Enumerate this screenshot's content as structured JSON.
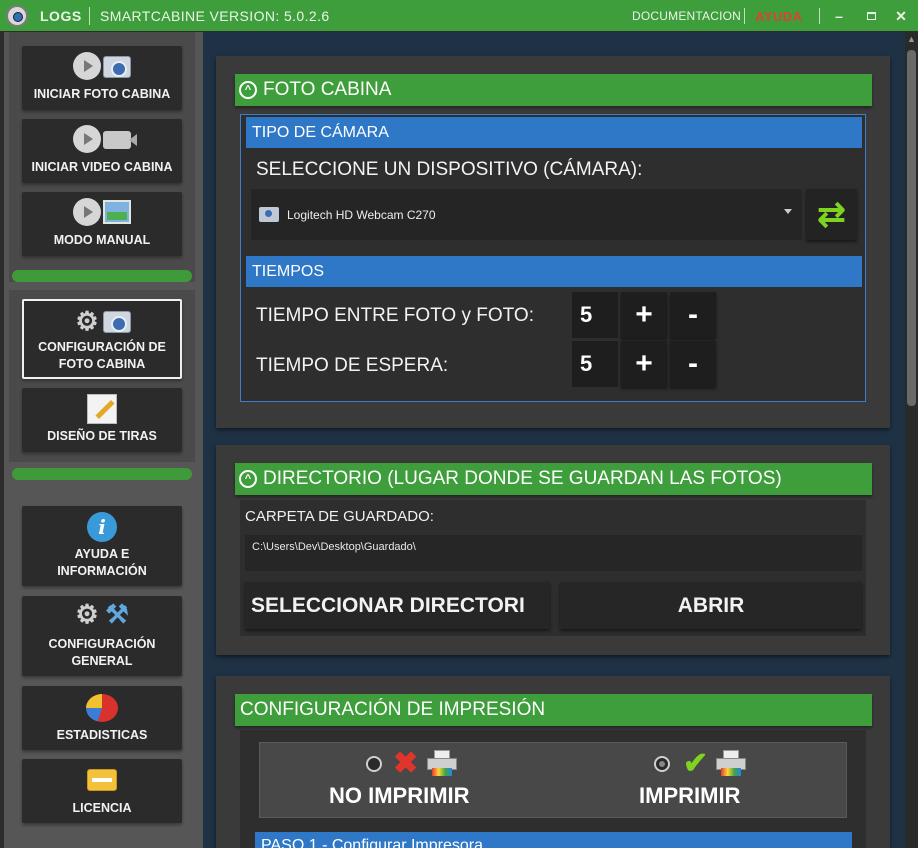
{
  "titlebar": {
    "logs_label": "LOGS",
    "version": "SMARTCABINE VERSION: 5.0.2.6",
    "documentation_link": "DOCUMENTACION",
    "help_link": "AYUDA",
    "minimize": "–",
    "maximize": "▫",
    "close": "✕"
  },
  "sidebar": {
    "group1": [
      {
        "label": "INICIAR FOTO CABINA"
      },
      {
        "label": "INICIAR VIDEO CABINA"
      },
      {
        "label": "MODO MANUAL"
      }
    ],
    "group2": [
      {
        "label_line1": "CONFIGURACIÓN DE",
        "label_line2": "FOTO CABINA"
      },
      {
        "label": "DISEÑO DE TIRAS"
      }
    ],
    "group3": [
      {
        "label_line1": "AYUDA E",
        "label_line2": "INFORMACIÓN"
      },
      {
        "label_line1": "CONFIGURACIÓN",
        "label_line2": "GENERAL"
      },
      {
        "label": "ESTADISTICAS"
      },
      {
        "label": "LICENCIA"
      }
    ]
  },
  "foto_cabina": {
    "title": "FOTO CABINA",
    "collapse_icon": "chevron-up-icon",
    "camera_type": {
      "header": "TIPO DE CÁMARA",
      "prompt": "SELECCIONE UN DISPOSITIVO (CÁMARA):",
      "selected_device": "Logitech HD Webcam C270"
    },
    "times": {
      "header": "TIEMPOS",
      "between_label": "TIEMPO ENTRE FOTO y FOTO:",
      "between_value": "5",
      "wait_label": "TIEMPO DE ESPERA:",
      "wait_value": "5",
      "plus": "+",
      "minus": "-"
    }
  },
  "directorio": {
    "title": "DIRECTORIO (LUGAR DONDE SE GUARDAN LAS FOTOS)",
    "folder_label": "CARPETA DE GUARDADO:",
    "folder_path": "C:\\Users\\Dev\\Desktop\\Guardado\\",
    "select_button": "SELECCIONAR DIRECTORI",
    "open_button": "ABRIR"
  },
  "impresion": {
    "title": "CONFIGURACIÓN DE IMPRESIÓN",
    "no_print_label": "NO IMPRIMIR",
    "print_label": "IMPRIMIR",
    "selected": "IMPRIMIR",
    "step_header": "PASO 1 - Configurar Impresora"
  },
  "colors": {
    "accent_green": "#3e9e3c",
    "accent_blue": "#2f78c8",
    "help_red": "#d9442e"
  }
}
